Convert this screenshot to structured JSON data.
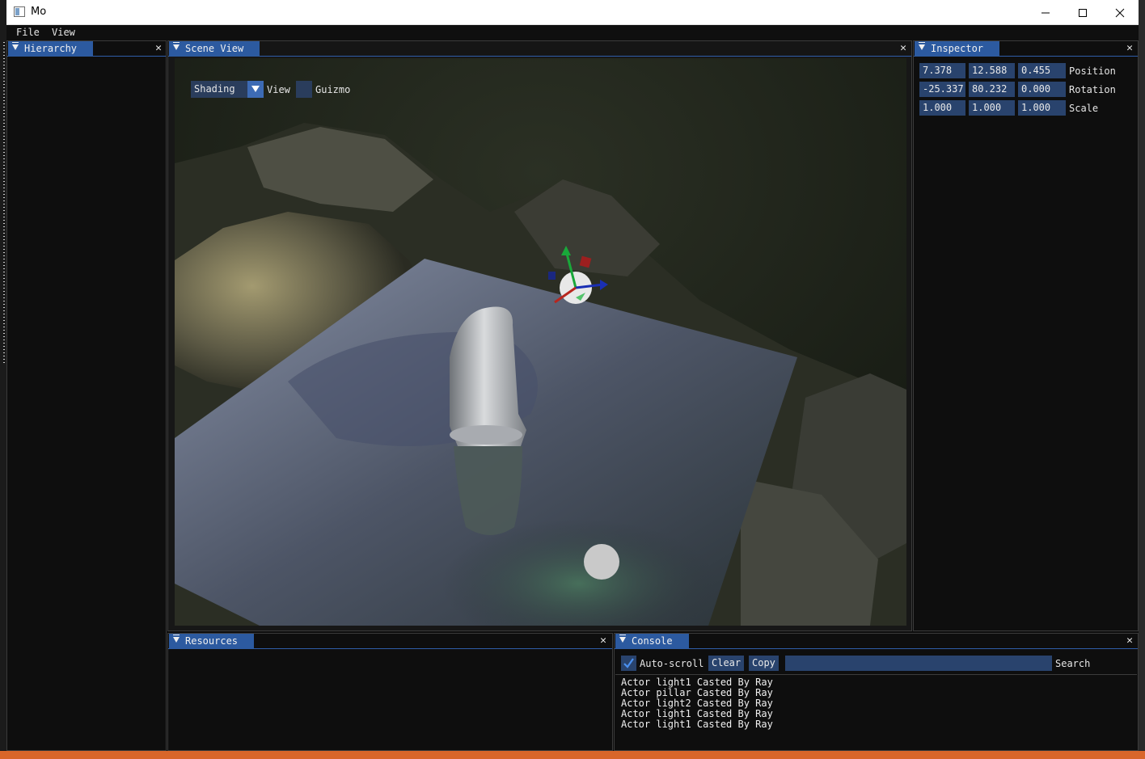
{
  "window": {
    "title": "Mo"
  },
  "menu": [
    "File",
    "View"
  ],
  "panels": {
    "hierarchy": {
      "title": "Hierarchy"
    },
    "scene": {
      "title": "Scene View",
      "shading": "Shading",
      "view_label": "View",
      "guizmo_label": "Guizmo"
    },
    "inspector": {
      "title": "Inspector",
      "rows": [
        {
          "label": "Position",
          "values": [
            "7.378",
            "12.588",
            "0.455"
          ]
        },
        {
          "label": "Rotation",
          "values": [
            "-25.337",
            "80.232",
            "0.000"
          ]
        },
        {
          "label": "Scale",
          "values": [
            "1.000",
            "1.000",
            "1.000"
          ]
        }
      ]
    },
    "resources": {
      "title": "Resources"
    },
    "console": {
      "title": "Console",
      "autoscroll_label": "Auto-scroll",
      "autoscroll_checked": true,
      "clear_label": "Clear",
      "copy_label": "Copy",
      "search_value": "",
      "search_label": "Search",
      "logs": [
        "Actor light1 Casted By Ray",
        "Actor pillar Casted By Ray",
        "Actor light2 Casted By Ray",
        "Actor light1 Casted By Ray",
        "Actor light1 Casted By Ray"
      ]
    }
  },
  "colors": {
    "tab_active": "#2c5aa0",
    "field_bg": "#29436d",
    "panel_bg": "#0e0e0e",
    "taskbar_accent": "#d9662a"
  }
}
